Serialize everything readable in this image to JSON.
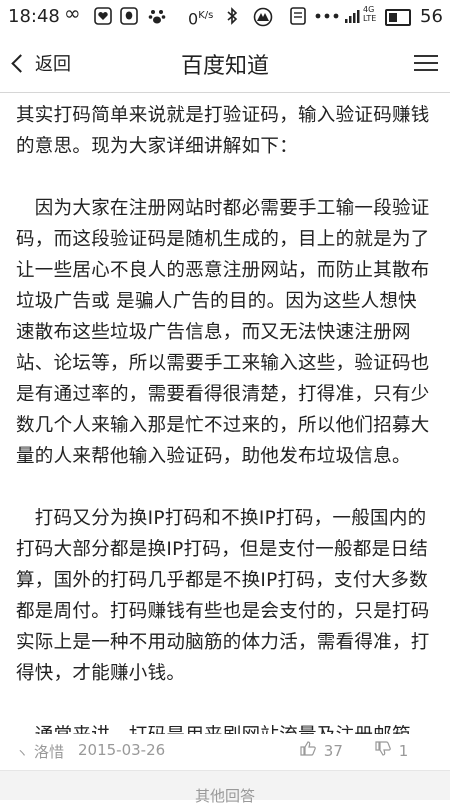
{
  "status_bar": {
    "time": "18:48",
    "speed": "0",
    "speed_unit": "K/s",
    "network": "4G",
    "network_sub": "LTE",
    "battery_level": "56",
    "battery_fraction": 0.56
  },
  "nav": {
    "back_label": "返回",
    "title": "百度知道"
  },
  "content": {
    "paragraphs": [
      "其实打码简单来说就是打验证码，输入验证码赚钱的意思。现为大家详细讲解如下：",
      "　因为大家在注册网站时都必需要手工输一段验证码，而这段验证码是随机生成的，目上的就是为了让一些居心不良人的恶意注册网站，而防止其散布垃圾广告或 是骗人广告的目的。因为这些人想快速散布这些垃圾广告信息，而又无法快速注册网站、论坛等，所以需要手工来输入这些，验证码也是有通过率的，需要看得很清楚，打得准，只有少数几个人来输入那是忙不过来的，所以他们招募大量的人来帮他输入验证码，助他发布垃圾信息。",
      "　打码又分为换IP打码和不换IP打码，一般国内的打码大部分都是换IP打码，但是支付一般都是日结算，国外的打码几乎都是不换IP打码，支付大多数都是周付。打码赚钱有些也是会支付的，只是打码实际上是一种不用动脑筋的体力活，需看得准，打得快，才能赚小钱。",
      "　通常来讲，打码是用来刷网站流量及注册邮箱，或是注册网站，再有就是投票，打码赚钱是一种恶意的注册方式赚钱，是非法的赚钱行为，被一些居心不良的人所操控，我个人并不推荐你参与打码赚"
    ]
  },
  "meta": {
    "author": "洛惜",
    "date": "2015-03-26",
    "likes": "37",
    "dislikes": "1"
  },
  "below": {
    "label": "其他回答"
  }
}
